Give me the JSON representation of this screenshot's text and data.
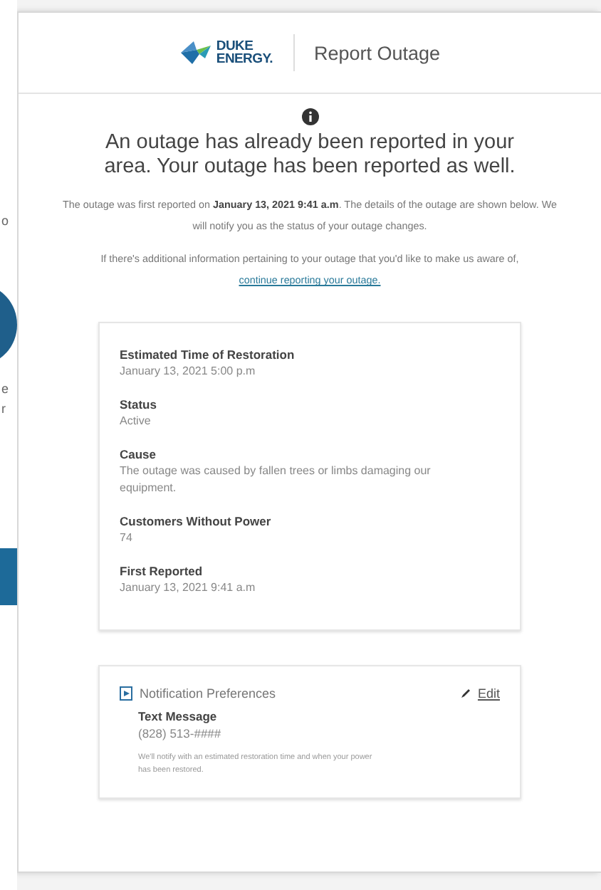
{
  "background_page": {
    "fragments": [
      "o",
      "e",
      "r"
    ]
  },
  "header": {
    "brand_top": "DUKE",
    "brand_bottom": "ENERGY.",
    "title": "Report Outage"
  },
  "message": {
    "heading": "An outage has already been reported in your area. Your outage has been reported as well.",
    "paragraph": "The outage was first reported on **January 13, 2021 9:41 a.m**. The details of the outage are shown below. We will notify you as the status of your outage changes.",
    "additional": "If there's additional information pertaining to your outage that you'd like to make us aware of,",
    "link": "continue reporting your outage."
  },
  "details": [
    {
      "label": "Estimated Time of Restoration",
      "value": "January 13, 2021 5:00 p.m"
    },
    {
      "label": "Status",
      "value": "Active"
    },
    {
      "label": "Cause",
      "value": "The outage was caused by fallen trees or limbs damaging our equipment."
    },
    {
      "label": "Customers Without Power",
      "value": "74"
    },
    {
      "label": "First Reported",
      "value": "January 13, 2021 9:41 a.m"
    }
  ],
  "notifications": {
    "title": "Notification Preferences",
    "edit": "Edit",
    "method": "Text Message",
    "phone": "(828) 513-####",
    "note": "We'll notify with an estimated restoration time and when your power has been restored."
  }
}
